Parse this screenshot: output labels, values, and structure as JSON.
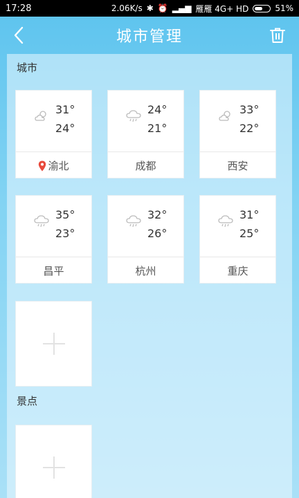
{
  "status_bar": {
    "time": "17:28",
    "net_speed": "2.06K/s",
    "carrier": "雁雁 4G+ HD",
    "battery": "51%"
  },
  "header": {
    "title": "城市管理",
    "back_icon": "chevron-left-icon",
    "delete_icon": "trash-icon"
  },
  "sections": {
    "cities_label": "城市",
    "spots_label": "景点"
  },
  "cities": [
    {
      "name": "渝北",
      "high": "31°",
      "low": "24°",
      "icon": "partly-cloudy-icon",
      "located": true
    },
    {
      "name": "成都",
      "high": "24°",
      "low": "21°",
      "icon": "rain-icon",
      "located": false
    },
    {
      "name": "西安",
      "high": "33°",
      "low": "22°",
      "icon": "partly-cloudy-icon",
      "located": false
    },
    {
      "name": "昌平",
      "high": "35°",
      "low": "23°",
      "icon": "rain-icon",
      "located": false
    },
    {
      "name": "杭州",
      "high": "32°",
      "low": "26°",
      "icon": "rain-icon",
      "located": false
    },
    {
      "name": "重庆",
      "high": "31°",
      "low": "25°",
      "icon": "rain-icon",
      "located": false
    }
  ],
  "colors": {
    "accent_location": "#e84a3c",
    "background_top": "#5cc3ee",
    "background_bottom": "#a9e0f7"
  }
}
